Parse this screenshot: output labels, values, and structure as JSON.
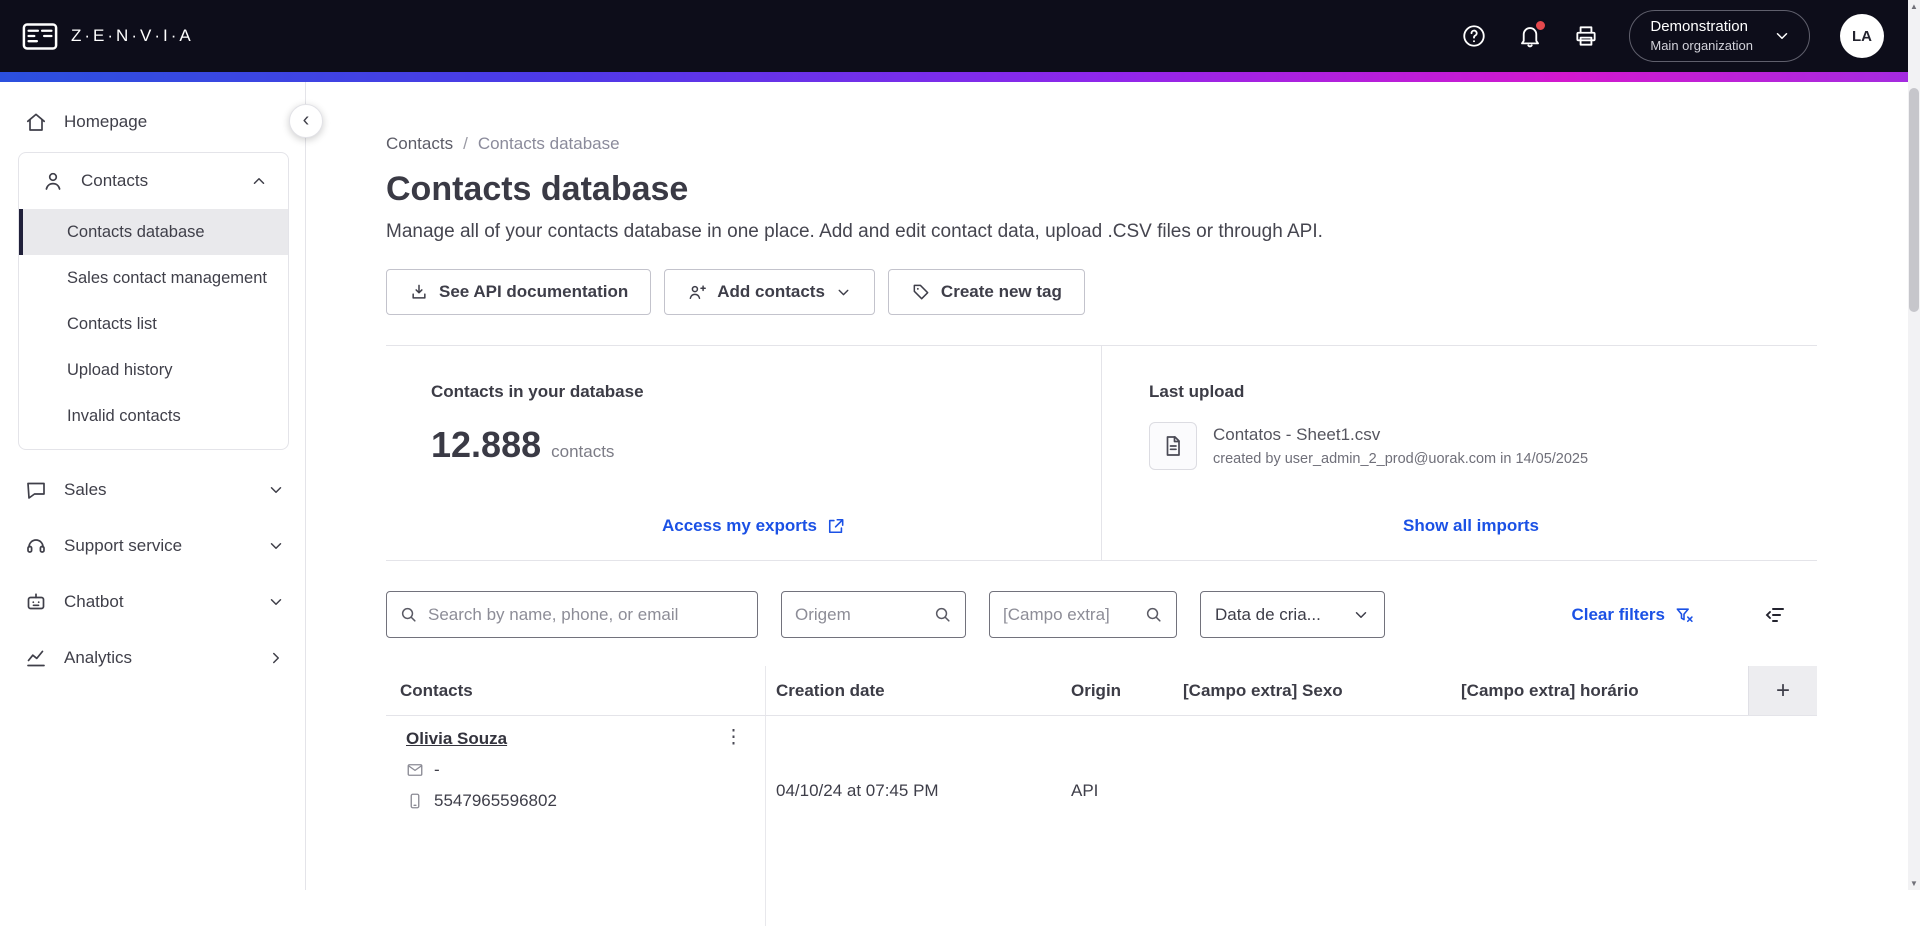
{
  "topbar": {
    "brand": "Z·E·N·V·I·A",
    "org_name": "Demonstration",
    "org_sub": "Main organization",
    "avatar": "LA"
  },
  "sidebar": {
    "homepage": "Homepage",
    "contacts": "Contacts",
    "contacts_items": [
      "Contacts database",
      "Sales contact management",
      "Contacts list",
      "Upload history",
      "Invalid contacts"
    ],
    "sales": "Sales",
    "support": "Support service",
    "chatbot": "Chatbot",
    "analytics": "Analytics",
    "collapse": "‹"
  },
  "breadcrumb": {
    "parent": "Contacts",
    "separator": "/",
    "current": "Contacts database"
  },
  "page": {
    "title": "Contacts database",
    "subtitle": "Manage all of your contacts database in one place. Add and edit contact data, upload .CSV files or through API."
  },
  "toolbar": {
    "api_docs": "See API documentation",
    "add_contacts": "Add contacts",
    "create_tag": "Create new tag"
  },
  "cards": {
    "database": {
      "title": "Contacts in your database",
      "count": "12.888",
      "unit": "contacts",
      "link": "Access my exports"
    },
    "upload": {
      "title": "Last upload",
      "filename": "Contatos - Sheet1.csv",
      "meta": "created by user_admin_2_prod@uorak.com in 14/05/2025",
      "link": "Show all imports"
    }
  },
  "filters": {
    "search_placeholder": "Search by name, phone, or email",
    "origin_placeholder": "Origem",
    "extra_placeholder": "[Campo extra]",
    "date_label": "Data de cria...",
    "clear": "Clear filters"
  },
  "table": {
    "headers": [
      "Contacts",
      "Creation date",
      "Origin",
      "[Campo extra] Sexo",
      "[Campo extra] horário"
    ],
    "add_column": "+",
    "kebab": "⋮",
    "rows": [
      {
        "name": "Olivia Souza",
        "email": "-",
        "phone": "5547965596802",
        "creation_date": "04/10/24 at 07:45 PM",
        "origin": "API"
      }
    ]
  },
  "colors": {
    "accent_blue": "#1B51E5",
    "topbar_bg": "#0D0D1A",
    "gradient_start": "#2B50DE",
    "gradient_mid": "#8F27EB",
    "gradient_end": "#A42BE0",
    "notification_red": "#E5484D",
    "active_item_bg": "#E9E9EC"
  }
}
